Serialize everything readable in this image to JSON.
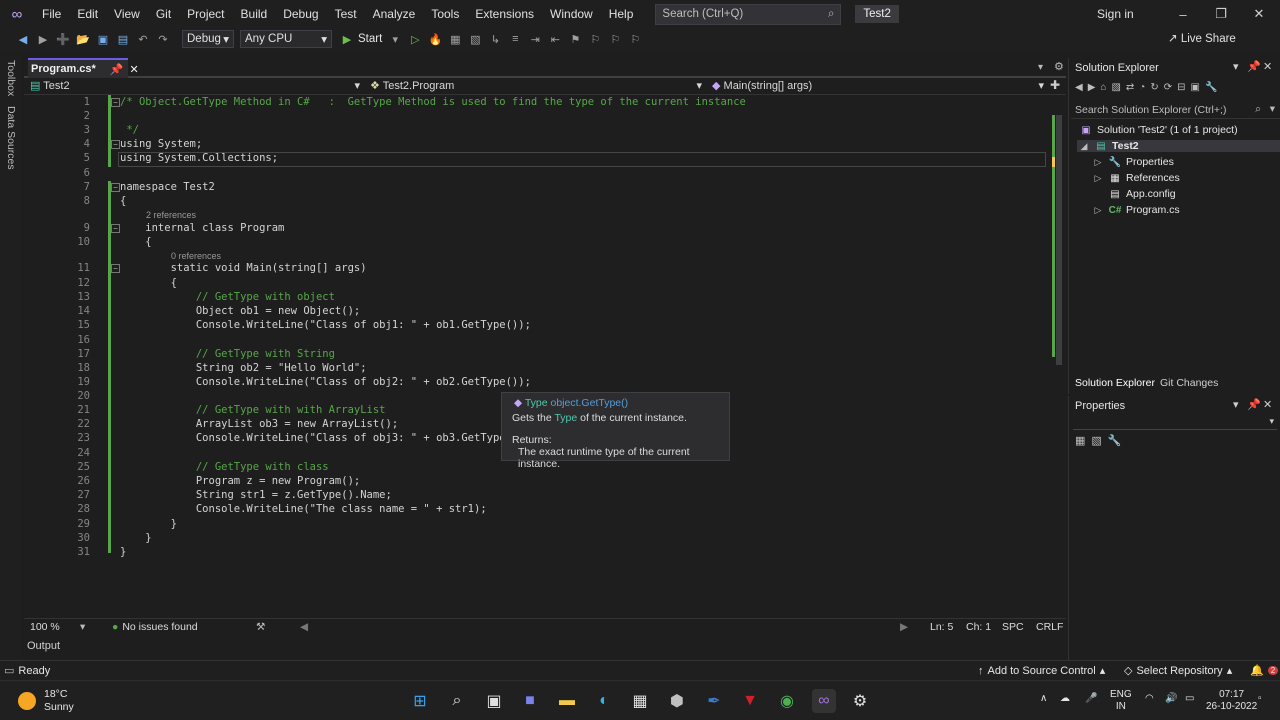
{
  "menu": {
    "items": [
      "File",
      "Edit",
      "View",
      "Git",
      "Project",
      "Build",
      "Debug",
      "Test",
      "Analyze",
      "Tools",
      "Extensions",
      "Window",
      "Help"
    ],
    "search_placeholder": "Search (Ctrl+Q)",
    "project_badge": "Test2",
    "sign_in": "Sign in"
  },
  "toolbar": {
    "config": "Debug",
    "platform": "Any CPU",
    "start_label": "Start",
    "live_share": "Live Share"
  },
  "left_strip": {
    "toolbox": "Toolbox",
    "data_sources": "Data Sources"
  },
  "editor": {
    "tab_label": "Program.cs*",
    "nav_project": "Test2",
    "nav_class": "Test2.Program",
    "nav_member": "Main(string[] args)",
    "lines": [
      {
        "n": "1",
        "text": "/* Object.GetType Method in C#   :  GetType Method is used to find the type of the current instance"
      },
      {
        "n": "2",
        "text": ""
      },
      {
        "n": "3",
        "text": " */"
      },
      {
        "n": "4",
        "text": "using System;"
      },
      {
        "n": "5",
        "text": "using System.Collections;"
      },
      {
        "n": "6",
        "text": ""
      },
      {
        "n": "7",
        "text": "namespace Test2"
      },
      {
        "n": "8",
        "text": "{"
      },
      {
        "n": "9",
        "text": "    internal class Program"
      },
      {
        "n": "10",
        "text": "    {"
      },
      {
        "n": "11",
        "text": "        static void Main(string[] args)"
      },
      {
        "n": "12",
        "text": "        {"
      },
      {
        "n": "13",
        "text": "            // GetType with object"
      },
      {
        "n": "14",
        "text": "            Object ob1 = new Object();"
      },
      {
        "n": "15",
        "text": "            Console.WriteLine(\"Class of obj1: \" + ob1.GetType());"
      },
      {
        "n": "16",
        "text": ""
      },
      {
        "n": "17",
        "text": "            // GetType with String"
      },
      {
        "n": "18",
        "text": "            String ob2 = \"Hello World\";"
      },
      {
        "n": "19",
        "text": "            Console.WriteLine(\"Class of obj2: \" + ob2.GetType());"
      },
      {
        "n": "20",
        "text": ""
      },
      {
        "n": "21",
        "text": "            // GetType with with ArrayList"
      },
      {
        "n": "22",
        "text": "            ArrayList ob3 = new ArrayList();"
      },
      {
        "n": "23",
        "text": "            Console.WriteLine(\"Class of obj3: \" + ob3.GetType"
      },
      {
        "n": "24",
        "text": ""
      },
      {
        "n": "25",
        "text": "            // GetType with class"
      },
      {
        "n": "26",
        "text": "            Program z = new Program();"
      },
      {
        "n": "27",
        "text": "            String str1 = z.GetType().Name;"
      },
      {
        "n": "28",
        "text": "            Console.WriteLine(\"The class name = \" + str1);"
      },
      {
        "n": "29",
        "text": "        }"
      },
      {
        "n": "30",
        "text": "    }"
      },
      {
        "n": "31",
        "text": "}"
      }
    ],
    "codelens_class": "2 references",
    "codelens_main": "0 references",
    "tooltip": {
      "type_word": "Type",
      "signature": "object.GetType()",
      "summary_pre": "Gets the",
      "summary_type": "Type",
      "summary_post": "of the current instance.",
      "returns_label": "Returns:",
      "returns_text": "The exact runtime type of the current instance."
    },
    "status": {
      "zoom": "100 %",
      "issues": "No issues found",
      "line": "Ln: 5",
      "col": "Ch: 1",
      "spc": "SPC",
      "eol": "CRLF"
    }
  },
  "output_tab": "Output",
  "solution_explorer": {
    "title": "Solution Explorer",
    "search_placeholder": "Search Solution Explorer (Ctrl+;)",
    "solution": "Solution 'Test2' (1 of 1 project)",
    "project": "Test2",
    "items": [
      "Properties",
      "References",
      "App.config",
      "Program.cs"
    ],
    "tab_solution": "Solution Explorer",
    "tab_git": "Git Changes"
  },
  "properties": {
    "title": "Properties"
  },
  "statusbar": {
    "ready": "Ready",
    "source_control": "Add to Source Control",
    "repository": "Select Repository",
    "notifications": "2"
  },
  "taskbar": {
    "temp": "18°C",
    "condition": "Sunny",
    "lang_1": "ENG",
    "lang_2": "IN",
    "time": "07:17",
    "date": "26-10-2022"
  },
  "colors": {
    "keyword": "#569cd6",
    "type": "#4ec9b0",
    "string": "#d69d85",
    "comment": "#57a64a",
    "accent": "#6d5ce7"
  }
}
